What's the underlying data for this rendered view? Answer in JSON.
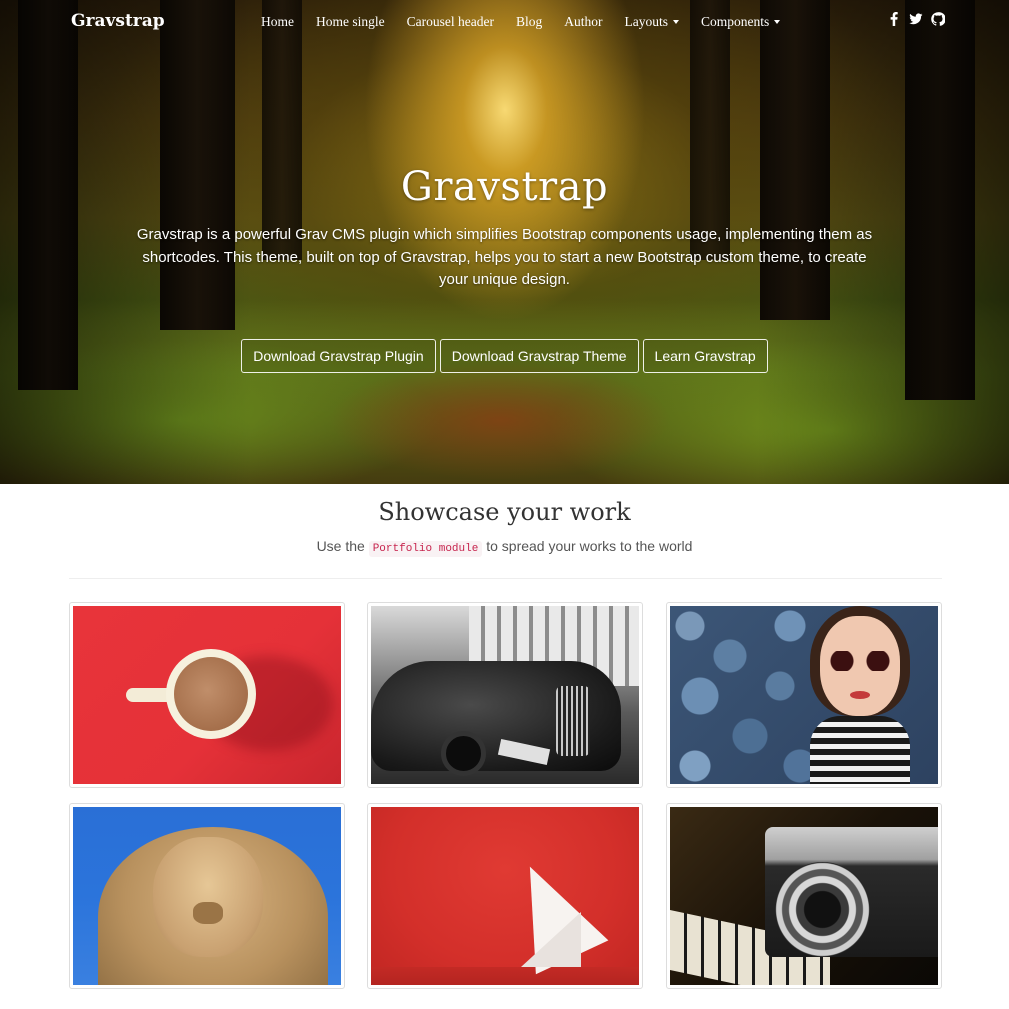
{
  "navbar": {
    "brand": "Gravstrap",
    "links": [
      {
        "label": "Home"
      },
      {
        "label": "Home single"
      },
      {
        "label": "Carousel header"
      },
      {
        "label": "Blog"
      },
      {
        "label": "Author"
      },
      {
        "label": "Layouts",
        "dropdown": true
      },
      {
        "label": "Components",
        "dropdown": true
      }
    ],
    "social_icons": [
      "facebook-icon",
      "twitter-icon",
      "github-icon"
    ]
  },
  "hero": {
    "title": "Gravstrap",
    "text": "Gravstrap is a powerful Grav CMS plugin which simplifies Bootstrap components usage, implementing them as shortcodes. This theme, built on top of Gravstrap, helps you to start a new Bootstrap custom theme, to create your unique design.",
    "buttons": [
      {
        "label": "Download Gravstrap Plugin"
      },
      {
        "label": "Download Gravstrap Theme"
      },
      {
        "label": "Learn Gravstrap"
      }
    ]
  },
  "showcase": {
    "title": "Showcase your work",
    "subtitle_before": "Use the ",
    "subtitle_code": "Portfolio module",
    "subtitle_after": " to spread your works to the world",
    "tiles": [
      {
        "subject": "coffee cup on red background"
      },
      {
        "subject": "black and white vintage car"
      },
      {
        "subject": "woman with sunglasses on blue pebbles"
      },
      {
        "subject": "lion statue against blue sky"
      },
      {
        "subject": "white origami bird on red background"
      },
      {
        "subject": "vintage camera on piano keys"
      }
    ]
  },
  "colors": {
    "nav_text": "#ffffff",
    "heading": "#333333",
    "code_text": "#c7254e",
    "code_bg": "#f9f2f4",
    "tile_border": "#dddddd"
  }
}
